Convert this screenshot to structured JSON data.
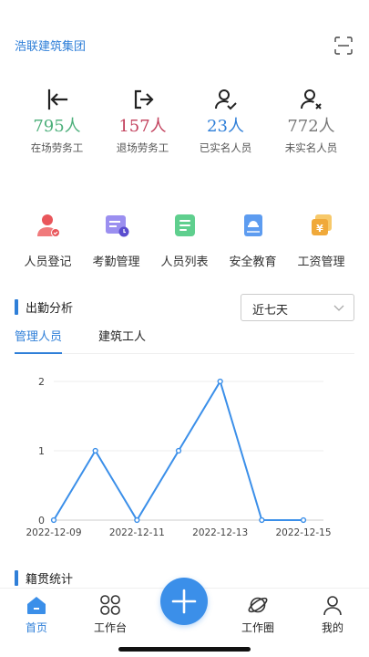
{
  "header": {
    "org_name": "浩联建筑集团"
  },
  "stats": [
    {
      "value": "795人",
      "label": "在场劳务工",
      "color": "#4caf7a",
      "icon": "arrow-left-in-icon"
    },
    {
      "value": "157人",
      "label": "退场劳务工",
      "color": "#c2405c",
      "icon": "arrow-right-out-icon"
    },
    {
      "value": "23人",
      "label": "已实名人员",
      "color": "#2f7fd8",
      "icon": "user-check-icon"
    },
    {
      "value": "772人",
      "label": "未实名人员",
      "color": "#777777",
      "icon": "user-x-icon"
    }
  ],
  "quick_actions": [
    {
      "label": "人员登记",
      "icon": "person-register-icon"
    },
    {
      "label": "考勤管理",
      "icon": "attendance-icon"
    },
    {
      "label": "人员列表",
      "icon": "list-icon"
    },
    {
      "label": "安全教育",
      "icon": "helmet-book-icon"
    },
    {
      "label": "工资管理",
      "icon": "salary-icon"
    }
  ],
  "attendance": {
    "title": "出勤分析",
    "range_selected": "近七天",
    "tabs": [
      {
        "label": "管理人员",
        "active": true
      },
      {
        "label": "建筑工人",
        "active": false
      }
    ]
  },
  "chart_data": {
    "type": "line",
    "x": [
      "2022-12-09",
      "2022-12-10",
      "2022-12-11",
      "2022-12-12",
      "2022-12-13",
      "2022-12-14",
      "2022-12-15"
    ],
    "x_tick_labels": [
      "2022-12-09",
      "2022-12-11",
      "2022-12-13",
      "2022-12-15"
    ],
    "series": [
      {
        "values": [
          0,
          1,
          0,
          1,
          2,
          0,
          0
        ]
      }
    ],
    "ylim": [
      0,
      2
    ],
    "y_ticks": [
      0,
      1,
      2
    ],
    "grid": true,
    "color": "#3b8fe9"
  },
  "origin_section": {
    "title": "籍贯统计"
  },
  "tabbar": {
    "items": [
      {
        "label": "首页",
        "icon": "home-icon",
        "active": true
      },
      {
        "label": "工作台",
        "icon": "workbench-icon",
        "active": false
      },
      {
        "label": "工作圈",
        "icon": "planet-icon",
        "active": false
      },
      {
        "label": "我的",
        "icon": "profile-icon",
        "active": false
      }
    ],
    "fab_icon": "plus-icon"
  }
}
